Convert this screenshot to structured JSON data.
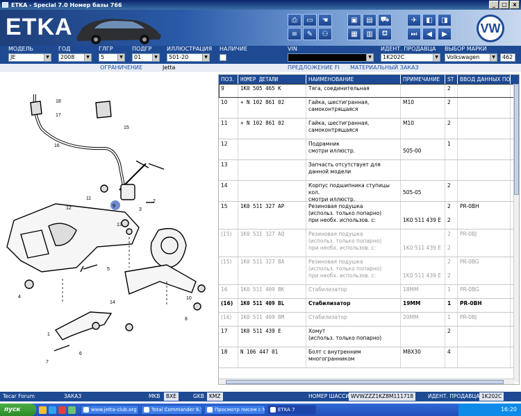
{
  "window": {
    "title": "ETKA - Special 7.0 Номер базы 766",
    "btn_min": "_",
    "btn_max": "□",
    "btn_close": "x"
  },
  "banner": {
    "logo": "ETKA"
  },
  "fields": {
    "model": {
      "label": "МОДЕЛЬ",
      "value": "JE"
    },
    "year": {
      "label": "ГОД",
      "value": "2008"
    },
    "glgr": {
      "label": "ГЛГР",
      "value": "5"
    },
    "podgr": {
      "label": "ПОДГР",
      "value": "01"
    },
    "illustration": {
      "label": "ИЛЛЮСТРАЦИЯ",
      "value": "501-20"
    },
    "availability": {
      "label": "НАЛИЧИЕ"
    },
    "vin": {
      "label": "VIN"
    },
    "seller_id": {
      "label": "ИДЕНТ. ПРОДАВЦА",
      "value": "1K202C"
    },
    "brand": {
      "label": "ВЫБОР МАРКИ",
      "value": "Volkswagen",
      "extra": "462"
    }
  },
  "subrow": {
    "restriction": "ОГРАНИЧЕНИЕ",
    "model_name": "Jetta",
    "offer": "ПРЕДЛОЖЕНИЕ FI",
    "material_order": "МАТЕРИАЛЬНЫЙ ЗАКАЗ"
  },
  "table": {
    "headers": [
      "ПОЗ.",
      "НОМЕР ДЕТАЛИ",
      "НАИМЕНОВАНИЕ",
      "ПРИМЕЧАНИЕ",
      "ST",
      "ВВОД ДАННЫХ ПО"
    ],
    "rows": [
      {
        "pos": "9",
        "part": "   1K0  505  465  K",
        "name": "Тяга, соединительная",
        "note": "",
        "st": "2",
        "data": "",
        "style": "sel",
        "h": 20
      },
      {
        "pos": "10",
        "part": "+ N    102  861  02",
        "name": "Гайка, шестигранная,\nсамоконтрящаяся",
        "note": "M10",
        "st": "2",
        "data": "",
        "style": "",
        "h": 30
      },
      {
        "pos": "11",
        "part": "+ N    102  861  02",
        "name": "Гайка, шестигранная,\nсамоконтрящаяся",
        "note": "M10",
        "st": "2",
        "data": "",
        "style": "",
        "h": 30
      },
      {
        "pos": "12",
        "part": "",
        "name": "Подрамник\n        смотри иллюстр.",
        "note": "\n505-00",
        "st": "1",
        "data": "",
        "style": "",
        "h": 30
      },
      {
        "pos": "13",
        "part": "",
        "name": "Запчасть отсутствует для\nданной модели",
        "note": "",
        "st": "",
        "data": "",
        "style": "",
        "h": 30
      },
      {
        "pos": "14",
        "part": "",
        "name": "Корпус подшипника ступицы кол.\n        смотри иллюстр.",
        "note": "\n505-05",
        "st": "2",
        "data": "",
        "style": "",
        "h": 30
      },
      {
        "pos": "15",
        "part": "   1K0  511  327  AP",
        "name": "Резиновая подушка\n(использ. только попарно)\n    при необх. использов. с:",
        "note": "\n\n1K0 511 439 E",
        "st": "2\n\n2",
        "data": "PR-0BH",
        "style": "",
        "h": 40
      },
      {
        "pos": "(15)",
        "part": "   1K0  511  327  AQ",
        "name": "Резиновая подушка\n(использ. только попарно)\n    при необх. использов. с:",
        "note": "\n\n1K0 511 439 E",
        "st": "2\n\n2",
        "data": "PR-0BJ",
        "style": "grey",
        "h": 40
      },
      {
        "pos": "(15)",
        "part": "   1K0  511  327  BA",
        "name": "Резиновая подушка\n(использ. только попарно)\n    при необх. использов. с:",
        "note": "\n\n1K0 511 439 E",
        "st": "2\n\n2",
        "data": "PR-0BG",
        "style": "grey",
        "h": 40
      },
      {
        "pos": "16",
        "part": "   1K0  511  409  BK",
        "name": "Стабилизатор",
        "note": "18MM",
        "st": "1",
        "data": "PR-0BG",
        "style": "grey",
        "h": 20
      },
      {
        "pos": "(16)",
        "part": "   1K0  511  409  BL",
        "name": "Стабилизатор",
        "note": "19MM",
        "st": "1",
        "data": "PR-0BH",
        "style": "bold",
        "h": 20
      },
      {
        "pos": "(16)",
        "part": "   1K0  511  409  BM",
        "name": "Стабилизатор",
        "note": "20MM",
        "st": "1",
        "data": "PR-0BJ",
        "style": "grey",
        "h": 20
      },
      {
        "pos": "17",
        "part": "   1K0  511  439  E",
        "name": "Хомут\n(использ. только попарно)",
        "note": "",
        "st": "2",
        "data": "",
        "style": "",
        "h": 30
      },
      {
        "pos": "18",
        "part": "   N    106  447  01",
        "name": "Болт с внутренним\nмногогранником",
        "note": "M8X30",
        "st": "4",
        "data": "",
        "style": "",
        "h": 30
      }
    ]
  },
  "diagram": {
    "labels": [
      "18",
      "17",
      "15",
      "16",
      "11",
      "9",
      "3",
      "2",
      "12",
      "13",
      "5",
      "4",
      "14",
      "10",
      "8",
      "1",
      "6",
      "7"
    ]
  },
  "statusbar": {
    "forum": "Tecar Forum",
    "order": "ЗАКАЗ",
    "mkb_label": "MKB",
    "mkb_value": "BXE",
    "gkb_label": "GKB",
    "gkb_value": "KMZ",
    "chassis_label": "НОМЕР ШАССИ",
    "chassis_value": "WVWZZZ1KZ8M111718",
    "seller_label": "ИДЕНТ. ПРОДАВЦА",
    "seller_value": "1K202C"
  },
  "taskbar": {
    "start": "пуск",
    "tasks": [
      "www.jetta-club.org ...",
      "Total Commander 6.5...",
      "Просмотр писем с М...",
      "ETKA 7"
    ],
    "time": "16:20"
  }
}
